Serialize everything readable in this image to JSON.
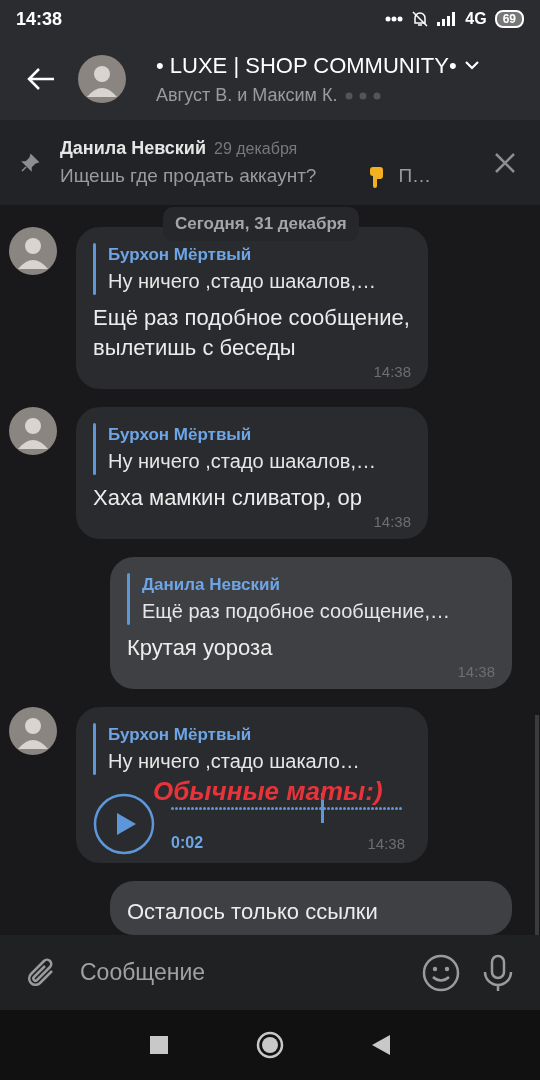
{
  "status_bar": {
    "time": "14:38",
    "network": "4G",
    "battery": "69"
  },
  "header": {
    "title": "• LUXE | SHOP COMMUNITY•",
    "subtitle": "Август В. и Максим К."
  },
  "pinned": {
    "author": "Данила Невский",
    "date": "29 декабря",
    "text": "Ищешь где продать аккаунт?",
    "preview": "П…"
  },
  "date_badge": "Сегодня, 31 декабря",
  "messages": [
    {
      "kind": "text",
      "outgoing": false,
      "quote": {
        "author": "Бурхон Мёртвый",
        "text": "Ну ничего ,стадо шакалов,…"
      },
      "text": "Ещё раз подобное сообщение, вылетишь с беседы",
      "time": "14:38"
    },
    {
      "kind": "text",
      "outgoing": false,
      "quote": {
        "author": "Бурхон Мёртвый",
        "text": "Ну ничего ,стадо шакалов,…"
      },
      "text": "Хаха мамкин сливатор, ор",
      "time": "14:38"
    },
    {
      "kind": "text",
      "outgoing": true,
      "quote": {
        "author": "Данила Невский",
        "text": "Ещё раз подобное сообщение,…"
      },
      "text": "Крутая уороза",
      "time": "14:38"
    },
    {
      "kind": "voice",
      "outgoing": false,
      "quote": {
        "author": "Бурхон Мёртвый",
        "text": "Ну ничего ,стадо шакало…"
      },
      "duration": "0:02",
      "level": 0.64,
      "time": "14:38",
      "annotation": "Обычные маты:)"
    },
    {
      "kind": "text",
      "outgoing": true,
      "text": "Осталось только ссылки"
    }
  ],
  "composer": {
    "placeholder": "Сообщение"
  }
}
